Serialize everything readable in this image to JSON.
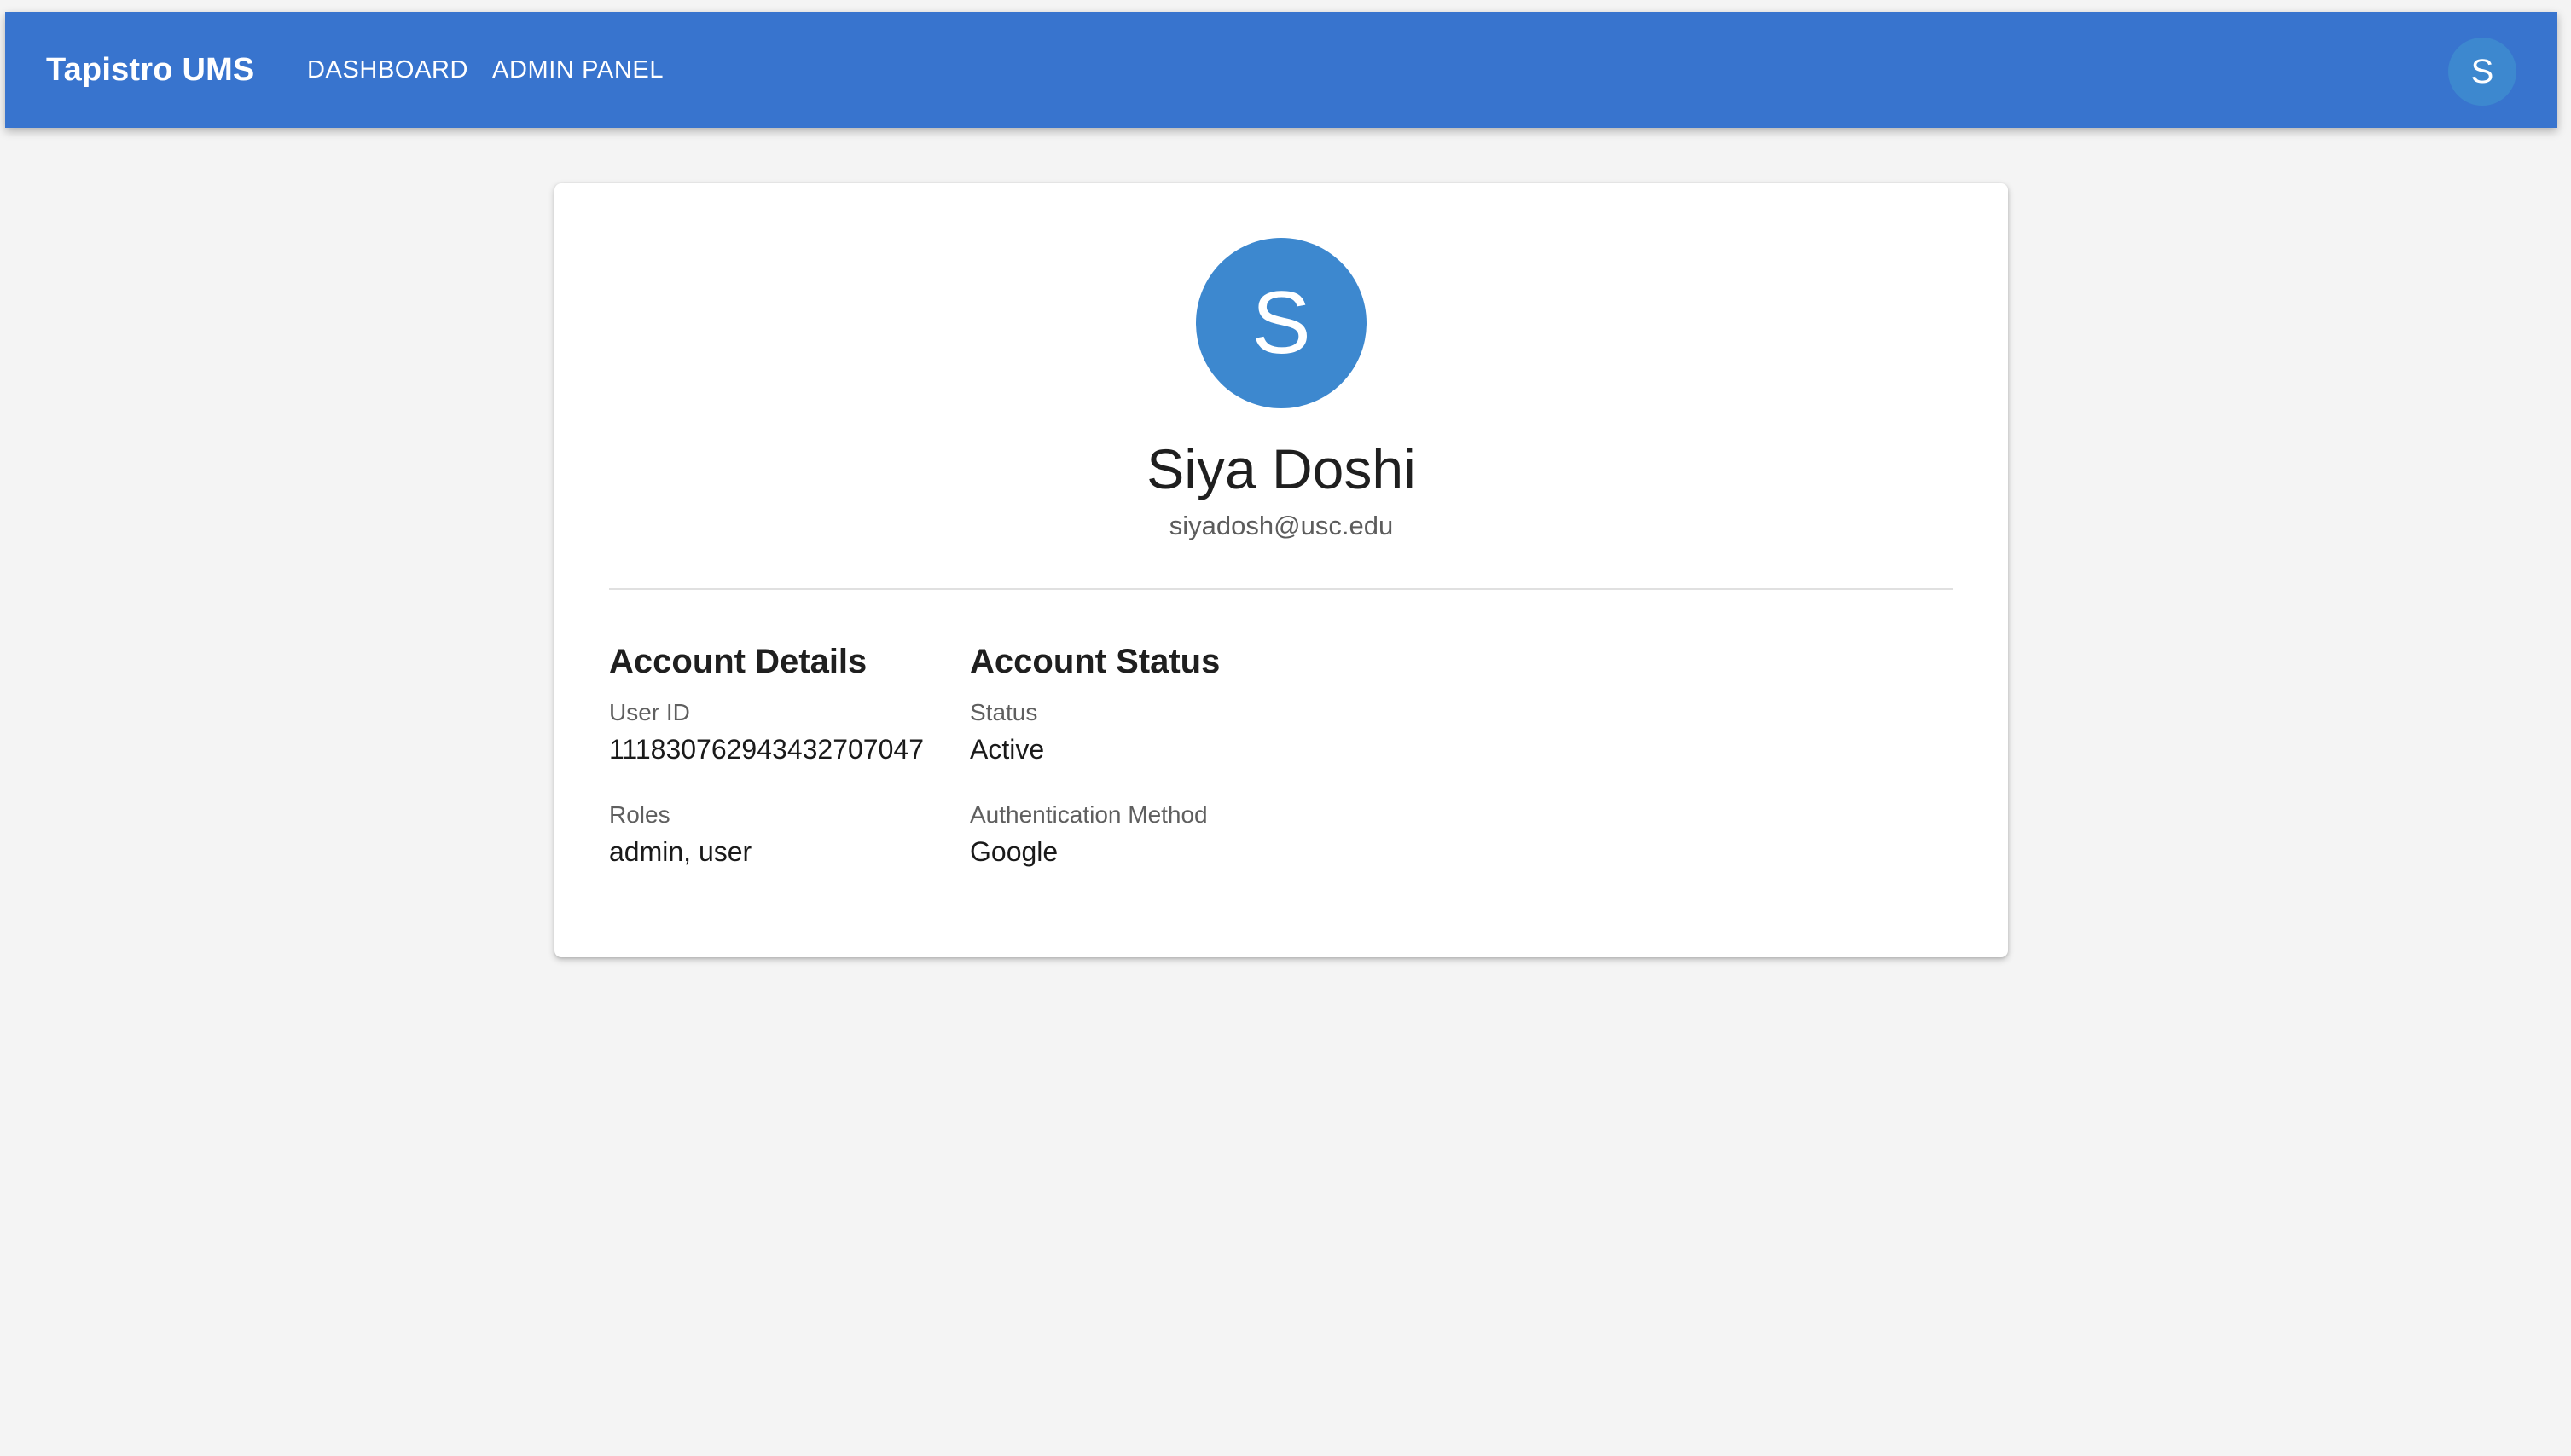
{
  "appbar": {
    "brand": "Tapistro UMS",
    "nav": {
      "dashboard": "DASHBOARD",
      "admin_panel": "ADMIN PANEL"
    },
    "avatar_initial": "S"
  },
  "profile": {
    "avatar_initial": "S",
    "name": "Siya Doshi",
    "email": "siyadosh@usc.edu"
  },
  "account_details": {
    "title": "Account Details",
    "user_id_label": "User ID",
    "user_id": "111830762943432707047",
    "roles_label": "Roles",
    "roles": "admin, user"
  },
  "account_status": {
    "title": "Account Status",
    "status_label": "Status",
    "status": "Active",
    "auth_method_label": "Authentication Method",
    "auth_method": "Google"
  },
  "colors": {
    "appbar": "#3874ce",
    "avatar": "#3d88cf",
    "background": "#f4f4f4"
  }
}
